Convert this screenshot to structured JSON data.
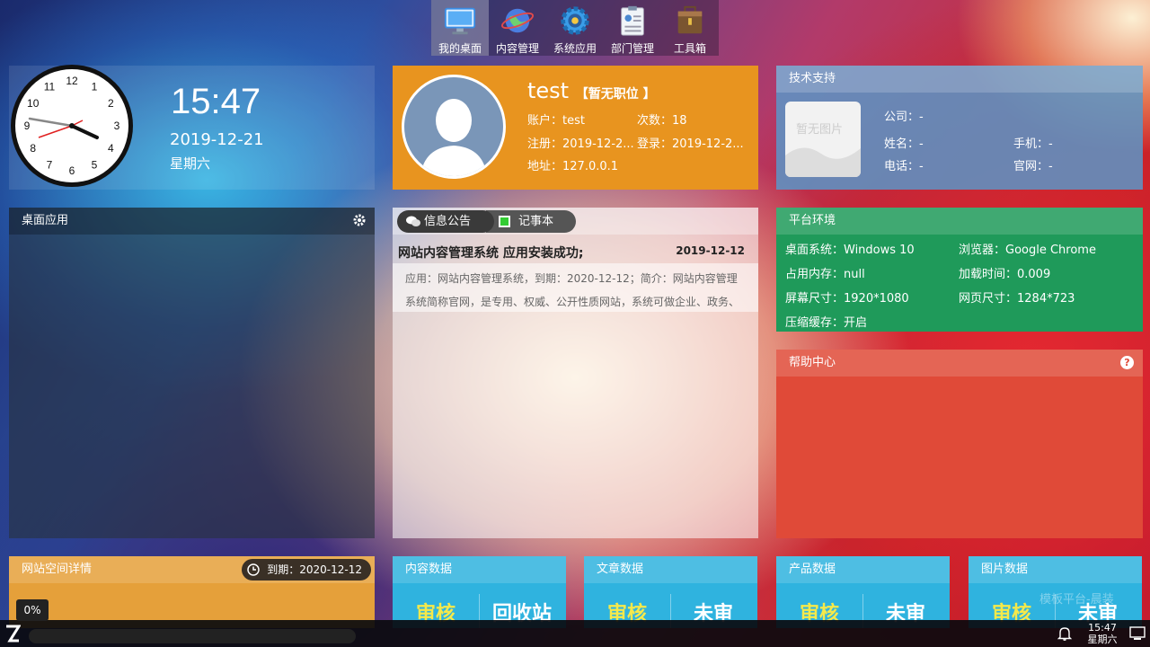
{
  "nav": {
    "items": [
      {
        "label": "我的桌面",
        "icon": "monitor-icon"
      },
      {
        "label": "内容管理",
        "icon": "globe-icon"
      },
      {
        "label": "系统应用",
        "icon": "gear-icon"
      },
      {
        "label": "部门管理",
        "icon": "id-card-icon"
      },
      {
        "label": "工具箱",
        "icon": "toolbox-icon"
      }
    ]
  },
  "clock": {
    "time": "15:47",
    "date": "2019-12-21",
    "weekday": "星期六",
    "numbers": [
      "12",
      "1",
      "2",
      "3",
      "4",
      "5",
      "6",
      "7",
      "8",
      "9",
      "10",
      "11"
    ]
  },
  "user": {
    "name": "test",
    "role": "【暂无职位 】",
    "account_label": "账户：test",
    "count_label": "次数：18",
    "register_label": "注册：2019-12-2...",
    "login_label": "登录：2019-12-2...",
    "address_label": "地址：127.0.0.1"
  },
  "tech": {
    "title": "技术支持",
    "no_image": "暂无图片",
    "company": "公司：-",
    "name": "姓名：-",
    "mobile": "手机：-",
    "phone": "电话：-",
    "website": "官网：-"
  },
  "desk": {
    "title": "桌面应用"
  },
  "notice": {
    "tab_notice": "信息公告",
    "tab_notes": "记事本",
    "item_title": "网站内容管理系统 应用安装成功;",
    "item_date": "2019-12-12",
    "item_body": "应用：网站内容管理系统，到期：2020-12-12；简介：网站内容管理系统简称官网，是专用、权威、公开性质网站，系统可做企业、政务、"
  },
  "env": {
    "title": "平台环境",
    "desktop": "桌面系统：Windows 10",
    "browser": "浏览器：Google Chrome",
    "memory": "占用内存：null",
    "load_time": "加载时间：0.009",
    "screen": "屏幕尺寸：1920*1080",
    "page": "网页尺寸：1284*723",
    "cache": "压缩缓存：开启"
  },
  "help": {
    "title": "帮助中心",
    "icon_text": "?"
  },
  "space": {
    "title": "网站空间详情",
    "expire": "到期：2020-12-12",
    "percent": "0%",
    "progress": 0
  },
  "stats": [
    {
      "title": "内容数据",
      "a": "审核",
      "b": "回收站"
    },
    {
      "title": "文章数据",
      "a": "审核",
      "b": "未审"
    },
    {
      "title": "产品数据",
      "a": "审核",
      "b": "未审"
    },
    {
      "title": "图片数据",
      "a": "审核",
      "b": "未审"
    }
  ],
  "watermark": "模板平台-晨装",
  "taskbar": {
    "time": "15:47",
    "weekday": "星期六"
  },
  "colors": {
    "user_card": "#e8941f",
    "env": "#1f9a5a",
    "help": "#e04a38",
    "stat": "#2fb3df",
    "space": "#e5a03a"
  }
}
